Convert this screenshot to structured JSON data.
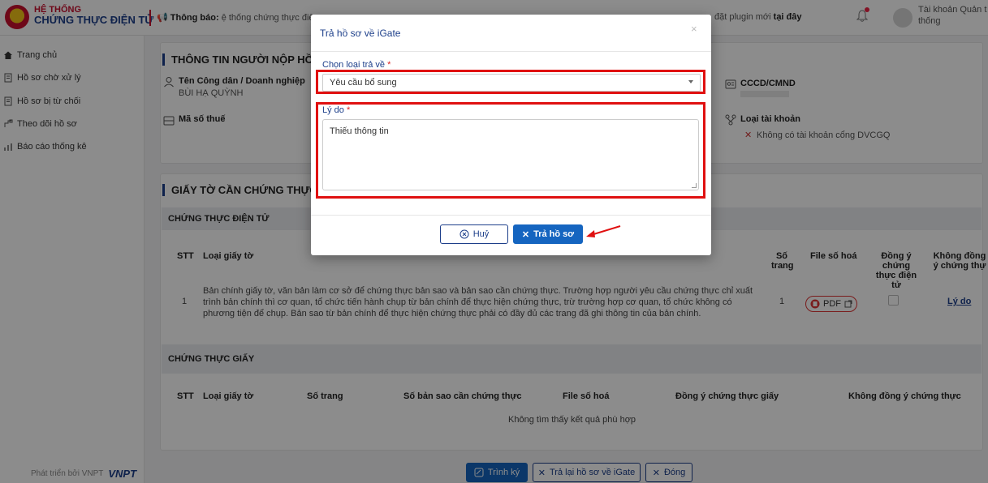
{
  "header": {
    "brand_line1": "HỆ THỐNG",
    "brand_line2": "CHỨNG THỰC ĐIỆN TỬ",
    "notice_label": "Thông báo:",
    "notice_text": "ệ thống chứng thực điệ",
    "notice_right_text": "đặt plugin mới",
    "notice_right_link": "tại đây",
    "account_line1": "Tài khoản Quản t",
    "account_line2": "thống"
  },
  "sidebar": {
    "items": [
      {
        "label": "Trang chủ",
        "icon": "home-icon"
      },
      {
        "label": "Hồ sơ chờ xử lý",
        "icon": "document-icon"
      },
      {
        "label": "Hồ sơ bị từ chối",
        "icon": "document-icon"
      },
      {
        "label": "Theo dõi hồ sơ",
        "icon": "track-icon"
      },
      {
        "label": "Báo cáo thống kê",
        "icon": "chart-icon"
      }
    ],
    "footer_text": "Phát triển bởi VNPT",
    "footer_logo": "VNPT"
  },
  "applicant": {
    "title": "THÔNG TIN NGƯỜI NỘP HỒ SƠ",
    "name_label": "Tên Công dân / Doanh nghiệp",
    "name_value": "BÙI HẠ QUỲNH",
    "tax_label": "Mã số thuế",
    "id_label": "CCCD/CMND",
    "id_value": "",
    "account_type_label": "Loại tài khoản",
    "account_type_value": "Không có tài khoản cổng DVCGQ"
  },
  "documents": {
    "title": "GIẤY TỜ CẦN CHỨNG THỰC",
    "electronic": {
      "band": "CHỨNG THỰC ĐIỆN TỬ",
      "columns": [
        "STT",
        "Loại giấy tờ",
        "Số trang",
        "File số hoá",
        "Đồng ý chứng thực điện tử",
        "Không đồng ý chứng thự"
      ],
      "rows": [
        {
          "stt": "1",
          "type": "Bản chính giấy tờ, văn bản làm cơ sở để chứng thực bản sao và bản sao cần chứng thực. Trường hợp người yêu cầu chứng thực chỉ xuất trình bản chính thì cơ quan, tổ chức tiến hành chụp từ bản chính để thực hiện chứng thực, trừ trường hợp cơ quan, tổ chức không có phương tiện để chụp. Bản sao từ bản chính để thực hiện chứng thực phải có đầy đủ các trang đã ghi thông tin của bản chính.",
          "pages": "1",
          "file": "PDF",
          "reason_link": "Lý do"
        }
      ]
    },
    "paper": {
      "band": "CHỨNG THỰC GIẤY",
      "columns": [
        "STT",
        "Loại giấy tờ",
        "Số trang",
        "Số bản sao cần chứng thực",
        "File số hoá",
        "Đồng ý chứng thực giấy",
        "Không đồng ý chứng thực"
      ],
      "empty_text": "Không tìm thấy kết quả phù hợp"
    }
  },
  "footer_buttons": {
    "sign": "Trình ký",
    "return_igate": "Trả lại hồ sơ về iGate",
    "close": "Đóng"
  },
  "modal": {
    "title": "Trả hồ sơ về iGate",
    "close_glyph": "×",
    "type_label": "Chọn loại trả về",
    "type_value": "Yêu cầu bổ sung",
    "reason_label": "Lý do",
    "reason_value": "Thiếu thông tin",
    "required_mark": "*",
    "cancel_button": "Huỷ",
    "submit_button": "Trả hồ sơ"
  },
  "colors": {
    "primary": "#1565c0",
    "brand_red": "#c8102e",
    "brand_navy": "#1d3f8a",
    "highlight": "#e01010"
  }
}
